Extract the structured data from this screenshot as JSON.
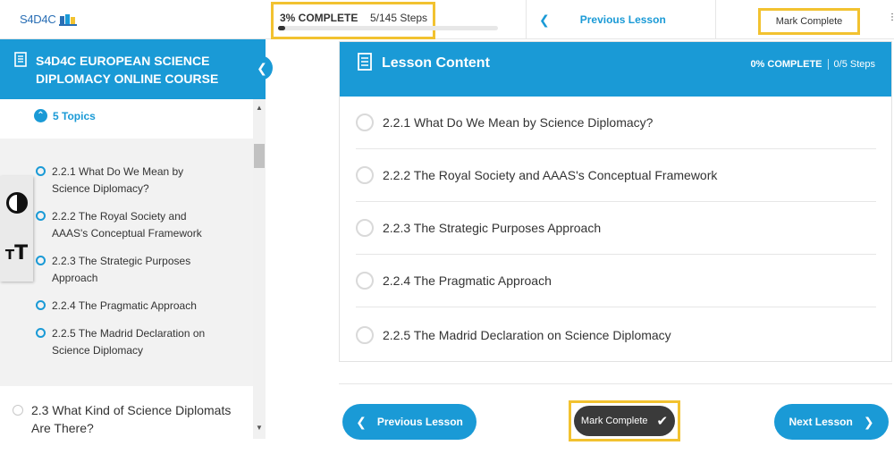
{
  "brand": {
    "logo_text": "S4D4C"
  },
  "progress": {
    "percent_label": "3% COMPLETE",
    "steps_label": "5/145 Steps",
    "fraction": 0.03
  },
  "top_nav": {
    "previous_label": "Previous Lesson",
    "mark_complete_label": "Mark Complete"
  },
  "sidebar": {
    "title": "S4D4C EUROPEAN SCIENCE DIPLOMACY ONLINE COURSE",
    "topics_toggle": "5 Topics",
    "topics": [
      {
        "label": "2.2.1 What Do We Mean by Science Diplomacy?"
      },
      {
        "label": "2.2.2 The Royal Society and AAAS's Conceptual Framework"
      },
      {
        "label": "2.2.3 The Strategic Purposes Approach"
      },
      {
        "label": "2.2.4 The Pragmatic Approach"
      },
      {
        "label": "2.2.5 The Madrid Declaration on Science Diplomacy"
      }
    ],
    "next_lesson": "2.3 What Kind of Science Diplomats Are There?"
  },
  "lesson_content": {
    "title": "Lesson Content",
    "progress_percent": "0% COMPLETE",
    "progress_steps": "0/5 Steps",
    "topics": [
      {
        "label": "2.2.1 What Do We Mean by Science Diplomacy?"
      },
      {
        "label": "2.2.2 The Royal Society and AAAS's Conceptual Framework"
      },
      {
        "label": "2.2.3 The Strategic Purposes Approach"
      },
      {
        "label": "2.2.4 The Pragmatic Approach"
      },
      {
        "label": "2.2.5 The Madrid Declaration on Science Diplomacy"
      }
    ]
  },
  "footer": {
    "previous_label": "Previous Lesson",
    "mark_complete_label": "Mark Complete",
    "next_label": "Next Lesson"
  },
  "colors": {
    "accent": "#1a9ad6",
    "highlight": "#f2c230",
    "dark_button": "#3a3a3a"
  }
}
